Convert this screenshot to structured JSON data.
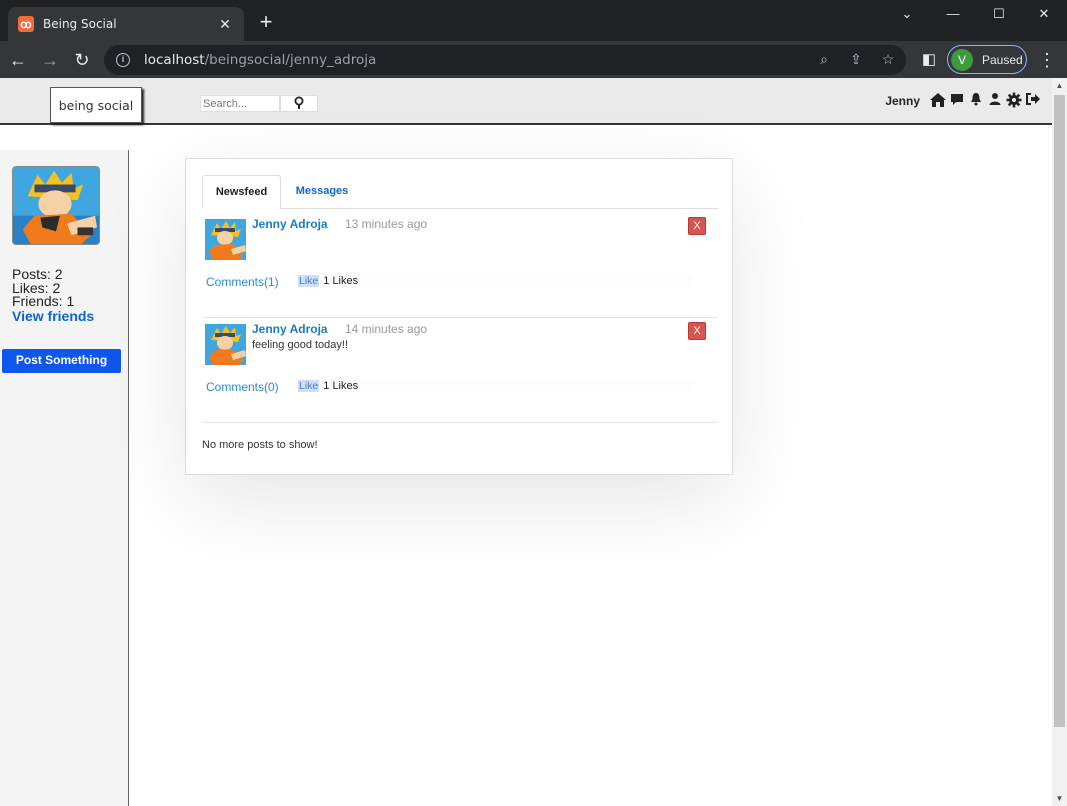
{
  "browser": {
    "tab_title": "Being Social",
    "tab_close": "✕",
    "new_tab": "+",
    "window_controls": [
      "⌄",
      "—",
      "☐",
      "✕"
    ],
    "url_host": "localhost",
    "url_path": "/beingsocial/jenny_adroja",
    "profile_initial": "V",
    "profile_status": "Paused",
    "colors": {
      "tabbar": "#202124",
      "toolbar": "#35363a"
    }
  },
  "header": {
    "logo_text": "being social",
    "search_placeholder": "Search...",
    "username": "Jenny",
    "nav_icons": [
      "home-icon",
      "messages-icon",
      "notifications-icon",
      "friend-requests-icon",
      "settings-icon",
      "logout-icon"
    ]
  },
  "sidebar": {
    "posts_label": "Posts: 2",
    "likes_label": "Likes: 2",
    "friends_label": "Friends: 1",
    "view_friends": "View friends",
    "post_button": "Post Something"
  },
  "feed": {
    "tabs": [
      {
        "label": "Newsfeed",
        "active": true
      },
      {
        "label": "Messages",
        "active": false
      }
    ],
    "posts": [
      {
        "author": "Jenny Adroja",
        "time": "13 minutes ago",
        "text": "",
        "delete": "X",
        "comments": "Comments(1)",
        "like": "Like",
        "likes": "1 Likes"
      },
      {
        "author": "Jenny Adroja",
        "time": "14 minutes ago",
        "text": "feeling good today!!",
        "delete": "X",
        "comments": "Comments(0)",
        "like": "Like",
        "likes": "1 Likes"
      }
    ],
    "end_message": "No more posts to show!"
  }
}
